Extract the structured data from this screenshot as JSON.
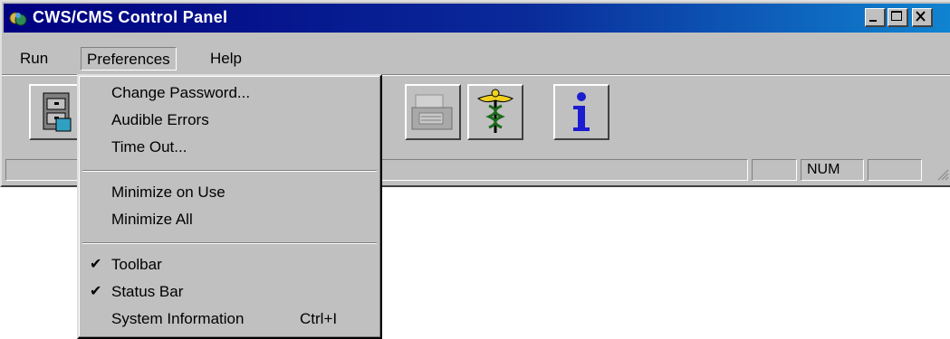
{
  "window": {
    "title": "CWS/CMS Control Panel",
    "controls": [
      "minimize-icon",
      "maximize-icon",
      "close-icon"
    ]
  },
  "menubar": {
    "items": [
      {
        "label": "Run"
      },
      {
        "label": "Preferences"
      },
      {
        "label": "Help"
      }
    ]
  },
  "toolbar": {
    "buttons": [
      {
        "icon": "file-cabinet-icon"
      },
      {
        "icon": "partially-hidden-icon"
      },
      {
        "icon": "green-box-icon"
      },
      {
        "icon": "printer-icon"
      },
      {
        "icon": "caduceus-icon"
      },
      {
        "icon": "info-icon"
      }
    ]
  },
  "statusbar": {
    "num_indicator": "NUM"
  },
  "preferences_menu": {
    "items": [
      {
        "label": "Change Password...",
        "checked": false
      },
      {
        "label": "Audible Errors",
        "checked": false
      },
      {
        "label": "Time Out...",
        "checked": false
      },
      {
        "label": "Minimize on Use",
        "checked": false
      },
      {
        "label": "Minimize All",
        "checked": false
      },
      {
        "label": "Toolbar",
        "checked": true
      },
      {
        "label": "Status Bar",
        "checked": true
      },
      {
        "label": "System Information",
        "shortcut": "Ctrl+I",
        "checked": false
      }
    ],
    "check_glyph": "✔"
  },
  "colors": {
    "titlebar_start": "#000080",
    "titlebar_end": "#1084d0",
    "face": "#c0c0c0",
    "info_blue": "#1c1cd0"
  }
}
